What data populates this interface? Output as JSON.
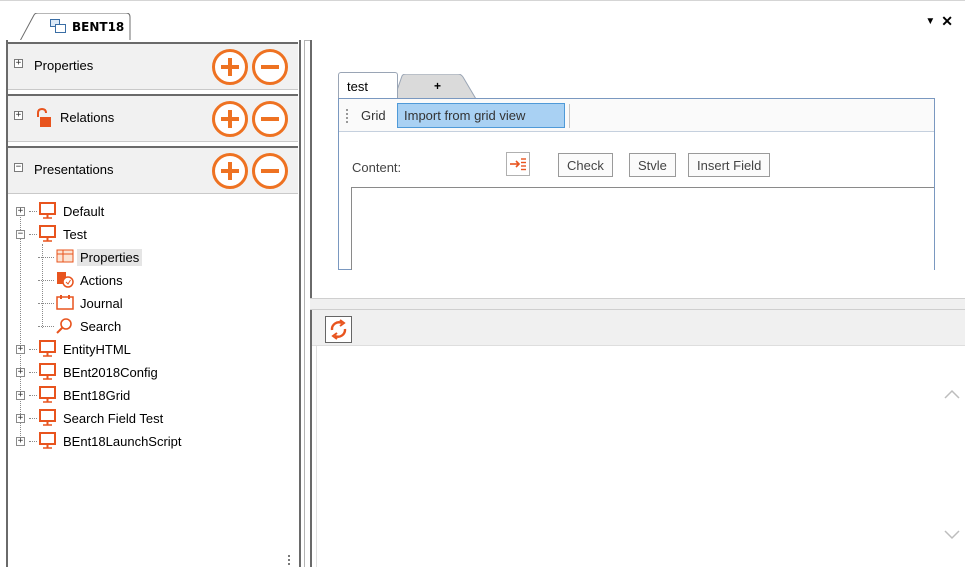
{
  "window": {
    "doc_tab_title": "BENT18",
    "dropdown_icon": "triangle-down-icon",
    "close_icon": "close-icon"
  },
  "left_panel": {
    "sections": [
      {
        "label": "Properties",
        "expander": "+",
        "icon": null
      },
      {
        "label": "Relations",
        "expander": "+",
        "icon": "unlock-icon"
      },
      {
        "label": "Presentations",
        "expander": "−",
        "icon": null
      }
    ],
    "add_icon": "plus-circle-icon",
    "remove_icon": "minus-circle-icon",
    "tree": [
      {
        "label": "Default",
        "expander": "+",
        "icon": "presentation-icon",
        "level": 0
      },
      {
        "label": "Test",
        "expander": "−",
        "icon": "presentation-icon",
        "level": 0
      },
      {
        "label": "Properties",
        "icon": "grid-icon",
        "level": 1,
        "selected": true
      },
      {
        "label": "Actions",
        "icon": "actions-icon",
        "level": 1
      },
      {
        "label": "Journal",
        "icon": "calendar-icon",
        "level": 1
      },
      {
        "label": "Search",
        "icon": "search-icon",
        "level": 1
      },
      {
        "label": "EntityHTML",
        "expander": "+",
        "icon": "presentation-icon",
        "level": 0
      },
      {
        "label": "BEnt2018Config",
        "expander": "+",
        "icon": "presentation-icon",
        "level": 0
      },
      {
        "label": "BEnt18Grid",
        "expander": "+",
        "icon": "presentation-icon",
        "level": 0
      },
      {
        "label": "Search Field Test",
        "expander": "+",
        "icon": "presentation-icon",
        "level": 0
      },
      {
        "label": "BEnt18LaunchScript",
        "expander": "+",
        "icon": "presentation-icon",
        "level": 0
      }
    ]
  },
  "editor": {
    "tabs": [
      "test",
      "+"
    ],
    "toolbar": {
      "grid_label": "Grid",
      "import_button": "Import from grid view"
    },
    "content_label": "Content:",
    "buttons": {
      "check": "Check",
      "style": "Stvle",
      "insert_field": "Insert Field"
    },
    "arrow_icon": "arrow-into-lines-icon"
  },
  "bottom_pane": {
    "refresh_icon": "refresh-icon",
    "scroll_up_icon": "chevron-up-icon",
    "scroll_down_icon": "chevron-down-icon"
  },
  "colors": {
    "accent_orange": "#ee7222",
    "selection_blue": "#a9d1f3",
    "presentation_red": "#e8541e"
  }
}
